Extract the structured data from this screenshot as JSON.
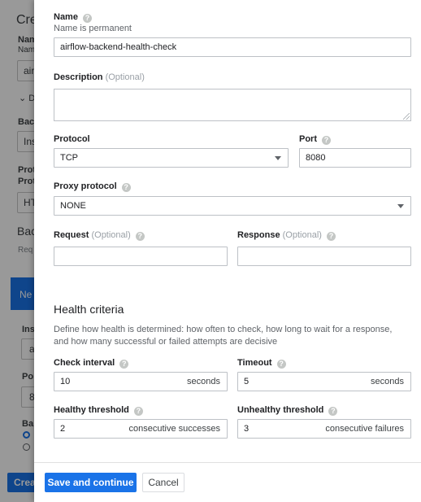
{
  "background": {
    "title_fragment": "Cre",
    "name_label_fragment": "Nam",
    "name_sub_fragment": "Nam",
    "name_value_fragment": "air",
    "expand_fragment": "D",
    "backend_label_fragment": "Back",
    "backend_value_fragment": "Ins",
    "protocol_label_fragment": "Prot",
    "protocol_label2_fragment": "Prot",
    "protocol_value_fragment": "HT",
    "backends_title_fragment": "Bac",
    "backends_sub_fragment": "Req",
    "new_backend_fragment": "Ne",
    "instance_label_fragment": "Ins",
    "instance_value_fragment": "a",
    "port_label_fragment": "Po",
    "port_value_fragment": "8",
    "balancing_label_fragment": "Ba",
    "create_button_fragment": "Crea"
  },
  "form": {
    "name_label": "Name",
    "name_sub": "Name is permanent",
    "name_value": "airflow-backend-health-check",
    "description_label": "Description",
    "description_optional": "(Optional)",
    "description_value": "",
    "protocol_label": "Protocol",
    "protocol_value": "TCP",
    "port_label": "Port",
    "port_value": "8080",
    "proxy_label": "Proxy protocol",
    "proxy_value": "NONE",
    "request_label": "Request",
    "request_optional": "(Optional)",
    "request_value": "",
    "response_label": "Response",
    "response_optional": "(Optional)",
    "response_value": ""
  },
  "health": {
    "title": "Health criteria",
    "description": "Define how health is determined: how often to check, how long to wait for a response, and how many successful or failed attempts are decisive",
    "check_interval_label": "Check interval",
    "check_interval_value": "10",
    "check_interval_unit": "seconds",
    "timeout_label": "Timeout",
    "timeout_value": "5",
    "timeout_unit": "seconds",
    "healthy_label": "Healthy threshold",
    "healthy_value": "2",
    "healthy_unit": "consecutive successes",
    "unhealthy_label": "Unhealthy threshold",
    "unhealthy_value": "3",
    "unhealthy_unit": "consecutive failures"
  },
  "footer": {
    "save_label": "Save and continue",
    "cancel_label": "Cancel"
  },
  "help_glyph": "?",
  "colors": {
    "primary": "#1a73e8",
    "scrim": "rgba(0,0,0,0.40)"
  }
}
